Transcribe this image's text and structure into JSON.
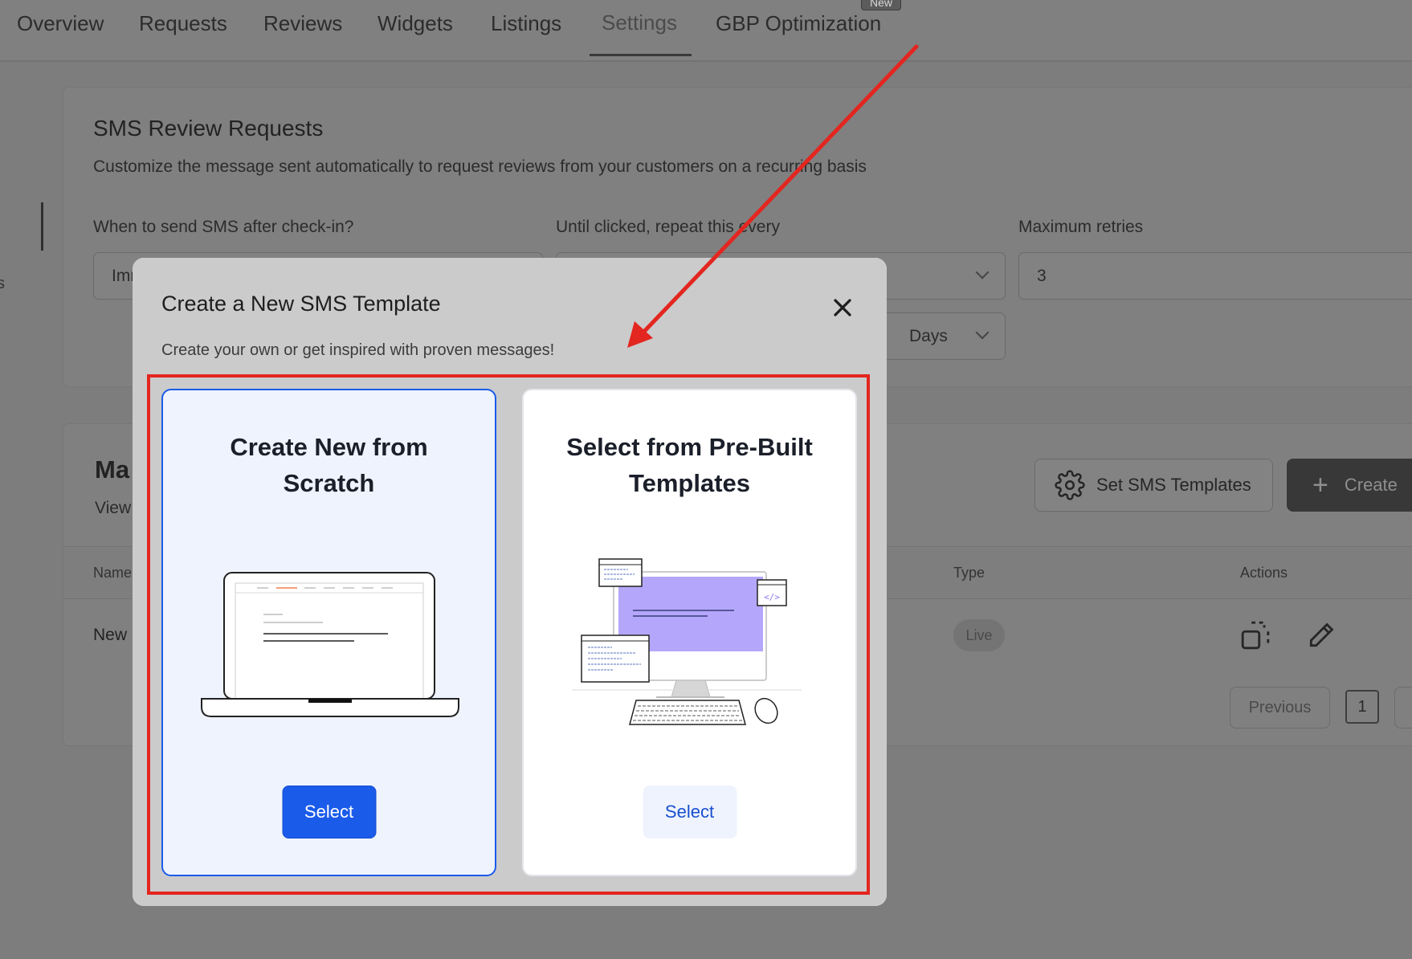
{
  "nav": {
    "tabs": [
      "Overview",
      "Requests",
      "Reviews",
      "Widgets",
      "Listings",
      "Settings",
      "GBP Optimization"
    ],
    "active_tab": "Settings",
    "new_badge": "New"
  },
  "side": {
    "partial_letter": "s"
  },
  "sms_section": {
    "title": "SMS Review Requests",
    "description": "Customize the message sent automatically to request reviews from your customers on a recurring basis",
    "when_label": "When to send SMS after check-in?",
    "when_value": "Imm",
    "repeat_label": "Until clicked, repeat this every",
    "repeat_unit": "Days",
    "retries_label": "Maximum retries",
    "retries_value": "3"
  },
  "templates_section": {
    "title_partial": "Ma",
    "desc_partial": "View",
    "set_templates_button": "Set SMS Templates",
    "create_button_partial": "Create",
    "columns": {
      "name": "Name",
      "type": "Type",
      "actions": "Actions"
    },
    "row": {
      "name_partial": "New",
      "type": "Live"
    },
    "pagination": {
      "previous": "Previous",
      "page": "1"
    }
  },
  "modal": {
    "title": "Create a New SMS Template",
    "subtitle": "Create your own or get inspired with proven messages!",
    "option_scratch": {
      "title": "Create New from Scratch",
      "button": "Select"
    },
    "option_prebuilt": {
      "title": "Select from Pre-Built Templates",
      "button": "Select"
    }
  },
  "colors": {
    "primary": "#1a5bea",
    "annotation": "#e3261f",
    "illustration_accent": "#b4a7fb"
  }
}
